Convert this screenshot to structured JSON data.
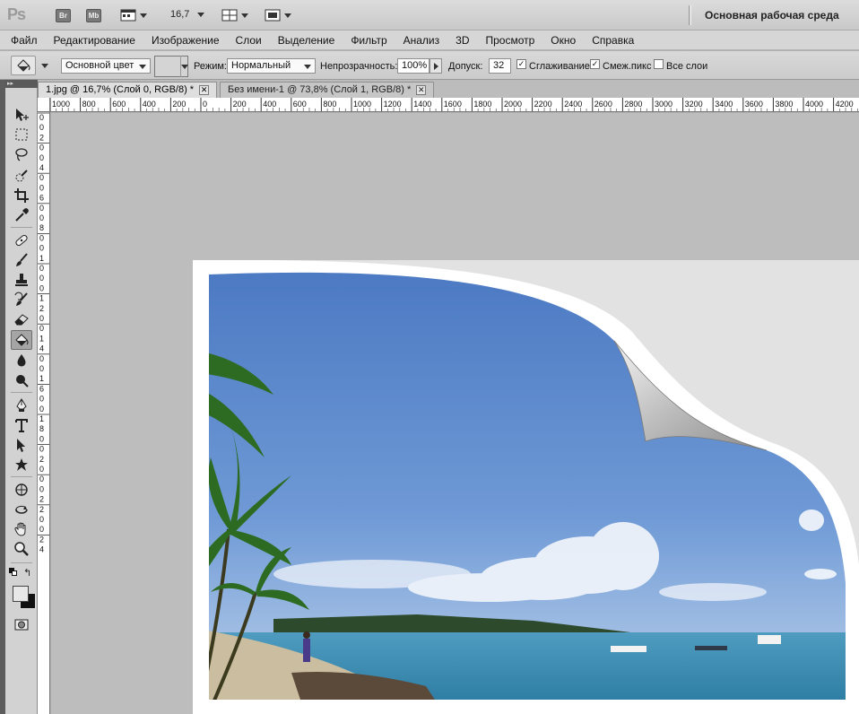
{
  "appbar": {
    "logo": "Ps",
    "bridge_label": "Br",
    "minibridge_label": "Mb",
    "zoom": "16,7",
    "workspace": "Основная рабочая среда"
  },
  "menu": [
    "Файл",
    "Редактирование",
    "Изображение",
    "Слои",
    "Выделение",
    "Фильтр",
    "Анализ",
    "3D",
    "Просмотр",
    "Окно",
    "Справка"
  ],
  "options": {
    "fill_source": "Основной цвет",
    "mode_label": "Режим:",
    "mode_value": "Нормальный",
    "opacity_label": "Непрозрачность:",
    "opacity_value": "100%",
    "tolerance_label": "Допуск:",
    "tolerance_value": "32",
    "antialias_label": "Сглаживание",
    "antialias_checked": true,
    "contiguous_label": "Смеж.пикс",
    "contiguous_checked": true,
    "all_layers_label": "Все слои",
    "all_layers_checked": false
  },
  "tabs": [
    {
      "label": "1.jpg @ 16,7% (Слой 0, RGB/8) *",
      "active": true
    },
    {
      "label": "Без имени-1 @ 73,8% (Слой 1, RGB/8) *",
      "active": false
    }
  ],
  "ruler": {
    "h_ticks": [
      "1000",
      "800",
      "600",
      "400",
      "200",
      "0",
      "200",
      "400",
      "600",
      "800",
      "1000",
      "1200",
      "1400",
      "1600",
      "1800",
      "2000",
      "2200",
      "2400",
      "2600",
      "2800",
      "3000",
      "3200",
      "3400",
      "3600",
      "3800",
      "4000",
      "4200"
    ],
    "v_ticks": [
      "0",
      "0",
      "2",
      "0",
      "0",
      "4",
      "0",
      "0",
      "6",
      "0",
      "0",
      "8",
      "0",
      "0",
      "1",
      "0",
      "0",
      "0",
      "1",
      "2",
      "0",
      "0",
      "1",
      "4",
      "0",
      "0",
      "1",
      "6",
      "0",
      "0",
      "1",
      "8",
      "0",
      "0",
      "2",
      "0",
      "0",
      "0",
      "2",
      "2",
      "0",
      "0",
      "2",
      "4"
    ]
  },
  "colors": {
    "foreground": "#e8e8e8",
    "background": "#111111"
  }
}
